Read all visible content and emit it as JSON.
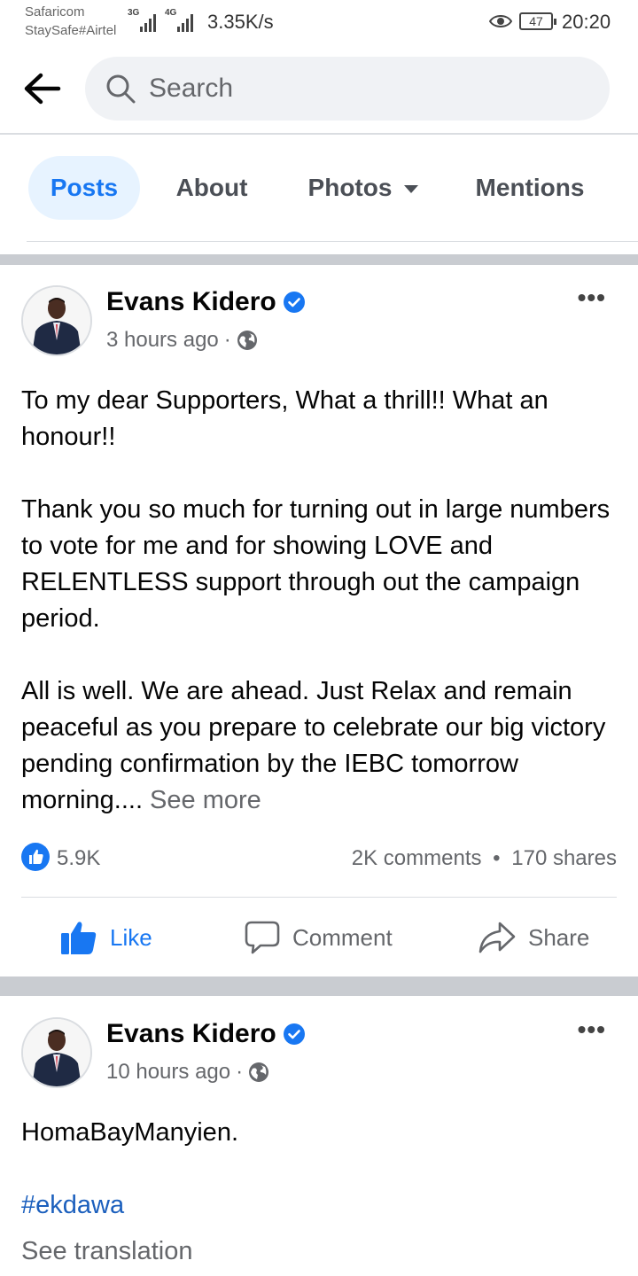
{
  "status_bar": {
    "carrier_1": "Safaricom",
    "carrier_2": "StaySafe#Airtel",
    "network_1": "3G",
    "network_2": "4G",
    "speed": "3.35K/s",
    "battery": "47",
    "time": "20:20"
  },
  "header": {
    "search_placeholder": "Search"
  },
  "tabs": [
    {
      "label": "Posts",
      "active": true
    },
    {
      "label": "About",
      "active": false
    },
    {
      "label": "Photos",
      "active": false
    },
    {
      "label": "Mentions",
      "active": false
    }
  ],
  "posts": [
    {
      "author": "Evans Kidero",
      "time": "3 hours ago",
      "dot": "·",
      "paragraphs": [
        "To my dear Supporters, What a thrill!! What an honour!!",
        "Thank you so much  for turning out in large numbers to vote for me and for showing LOVE and RELENTLESS support through out the campaign period.",
        "All is well. We are ahead. Just Relax and remain peaceful as you prepare to celebrate our big victory pending confirmation by the IEBC tomorrow morning...."
      ],
      "see_more": " See more",
      "likes": "5.9K",
      "comments": "2K comments",
      "bullet": "•",
      "shares": "170 shares",
      "actions": {
        "like": "Like",
        "comment": "Comment",
        "share": "Share"
      }
    },
    {
      "author": "Evans Kidero",
      "time": "10 hours ago",
      "dot": "·",
      "text": "HomaBayManyien.",
      "hashtag": "#ekdawa",
      "see_translation": "See translation"
    }
  ],
  "colors": {
    "accent": "#1877f2",
    "secondary_text": "#65676b",
    "separator": "#c9ccd1"
  }
}
